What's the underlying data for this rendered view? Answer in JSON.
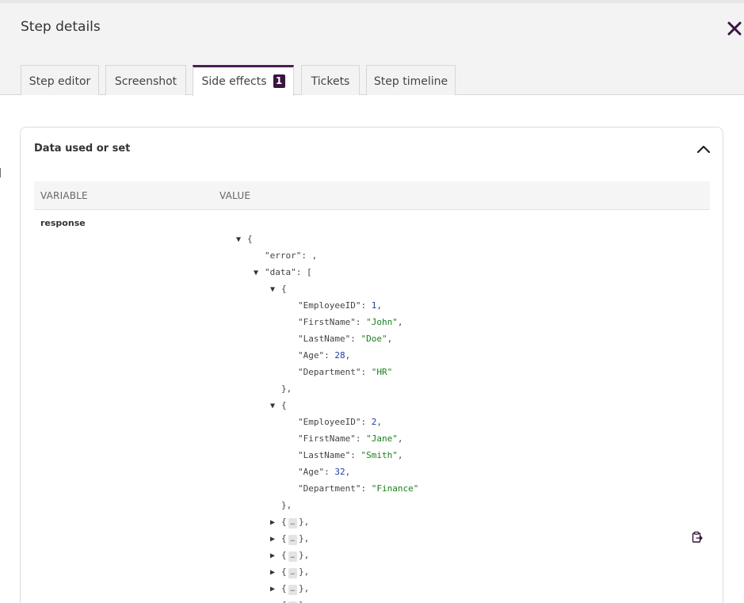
{
  "modal": {
    "title": "Step details",
    "close_icon": "close-icon"
  },
  "tabs": [
    {
      "label": "Step editor",
      "active": false
    },
    {
      "label": "Screenshot",
      "active": false
    },
    {
      "label": "Side effects",
      "active": true,
      "badge": "1"
    },
    {
      "label": "Tickets",
      "active": false
    },
    {
      "label": "Step timeline",
      "active": false
    }
  ],
  "panel": {
    "title": "Data used or set",
    "collapse_icon": "chevron-up-icon",
    "columns": {
      "variable": "VARIABLE",
      "value": "VALUE"
    },
    "row": {
      "variable": "response",
      "copy_icon": "clipboard-icon"
    }
  },
  "json_tree": {
    "root_open": "{",
    "error_key": "\"error\"",
    "data_key": "\"data\"",
    "data_open": "[",
    "records": [
      {
        "fields": [
          {
            "key": "\"EmployeeID\"",
            "value": "1",
            "type": "num"
          },
          {
            "key": "\"FirstName\"",
            "value": "\"John\"",
            "type": "str"
          },
          {
            "key": "\"LastName\"",
            "value": "\"Doe\"",
            "type": "str"
          },
          {
            "key": "\"Age\"",
            "value": "28",
            "type": "num"
          },
          {
            "key": "\"Department\"",
            "value": "\"HR\"",
            "type": "str"
          }
        ]
      },
      {
        "fields": [
          {
            "key": "\"EmployeeID\"",
            "value": "2",
            "type": "num"
          },
          {
            "key": "\"FirstName\"",
            "value": "\"Jane\"",
            "type": "str"
          },
          {
            "key": "\"LastName\"",
            "value": "\"Smith\"",
            "type": "str"
          },
          {
            "key": "\"Age\"",
            "value": "32",
            "type": "num"
          },
          {
            "key": "\"Department\"",
            "value": "\"Finance\"",
            "type": "str"
          }
        ]
      }
    ],
    "collapsed_count": 6,
    "ellipsis": "…",
    "colors": {
      "string": "#1a7f1a",
      "number": "#1b3fa0"
    }
  },
  "theme": {
    "accent": "#4a1d52",
    "badge": "#3a1540"
  }
}
